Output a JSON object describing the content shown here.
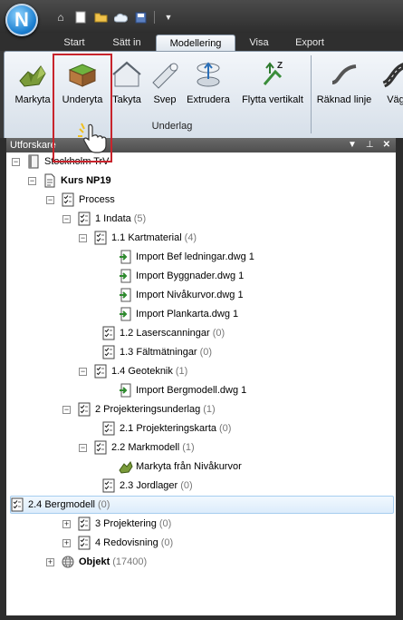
{
  "app": {
    "logo_letter": "N"
  },
  "qat": {
    "icons": [
      "home-icon",
      "new-file-icon",
      "open-folder-icon",
      "cloud-icon",
      "save-icon",
      "dropdown-arrow-icon"
    ]
  },
  "tabs": [
    {
      "label": "Start"
    },
    {
      "label": "Sätt in"
    },
    {
      "label": "Modellering",
      "active": true
    },
    {
      "label": "Visa"
    },
    {
      "label": "Export"
    }
  ],
  "ribbon": {
    "buttons": [
      {
        "label": "Markyta",
        "icon": "terrain-surface-icon"
      },
      {
        "label": "Underyta",
        "icon": "subsurface-icon",
        "highlighted": true
      },
      {
        "label": "Takyta",
        "icon": "roof-surface-icon"
      },
      {
        "label": "Svep",
        "icon": "sweep-icon"
      },
      {
        "label": "Extrudera",
        "icon": "extrude-icon"
      },
      {
        "label": "Flytta vertikalt",
        "icon": "move-vertical-icon"
      },
      {
        "label": "Räknad linje",
        "icon": "calculated-line-icon"
      },
      {
        "label": "Väg",
        "icon": "road-icon"
      }
    ],
    "group_label": "Underlag"
  },
  "panel": {
    "title": "Utforskare",
    "controls": [
      "dropdown-arrow-icon",
      "pin-icon",
      "close-icon"
    ]
  },
  "tree": [
    {
      "label": "Stockholm TrV",
      "count": "",
      "level": 0,
      "expander": "-",
      "icon": "book-icon"
    },
    {
      "label": "Kurs NP19",
      "count": "",
      "level": 1,
      "expander": "-",
      "icon": "document-icon",
      "bold": true
    },
    {
      "label": "Process",
      "count": "",
      "level": 2,
      "expander": "-",
      "icon": "checklist-icon"
    },
    {
      "label": "1 Indata",
      "count": "(5)",
      "level": 3,
      "expander": "-",
      "icon": "checklist-icon"
    },
    {
      "label": "1.1 Kartmaterial",
      "count": "(4)",
      "level": 4,
      "expander": "-",
      "icon": "checklist-icon"
    },
    {
      "label": "Import Bef ledningar.dwg 1",
      "count": "",
      "level": 6,
      "expander": "",
      "icon": "import-icon"
    },
    {
      "label": "Import Byggnader.dwg 1",
      "count": "",
      "level": 6,
      "expander": "",
      "icon": "import-icon"
    },
    {
      "label": "Import Nivåkurvor.dwg 1",
      "count": "",
      "level": 6,
      "expander": "",
      "icon": "import-icon"
    },
    {
      "label": "Import Plankarta.dwg 1",
      "count": "",
      "level": 6,
      "expander": "",
      "icon": "import-icon"
    },
    {
      "label": "1.2 Laserscanningar",
      "count": "(0)",
      "level": 5,
      "expander": "",
      "icon": "checklist-icon"
    },
    {
      "label": "1.3 Fältmätningar",
      "count": "(0)",
      "level": 5,
      "expander": "",
      "icon": "checklist-icon"
    },
    {
      "label": "1.4 Geoteknik",
      "count": "(1)",
      "level": 4,
      "expander": "-",
      "icon": "checklist-icon"
    },
    {
      "label": "Import Bergmodell.dwg 1",
      "count": "",
      "level": 6,
      "expander": "",
      "icon": "import-icon"
    },
    {
      "label": "2 Projekteringsunderlag",
      "count": "(1)",
      "level": 3,
      "expander": "-",
      "icon": "checklist-icon"
    },
    {
      "label": "2.1 Projekteringskarta",
      "count": "(0)",
      "level": 5,
      "expander": "",
      "icon": "checklist-icon"
    },
    {
      "label": "2.2 Markmodell",
      "count": "(1)",
      "level": 4,
      "expander": "-",
      "icon": "checklist-icon"
    },
    {
      "label": "Markyta från Nivåkurvor",
      "count": "",
      "level": 6,
      "expander": "",
      "icon": "terrain-surface-icon"
    },
    {
      "label": "2.3 Jordlager",
      "count": "(0)",
      "level": 5,
      "expander": "",
      "icon": "checklist-icon"
    },
    {
      "label": "2.4 Bergmodell",
      "count": "(0)",
      "level": 5,
      "expander": "",
      "icon": "checklist-icon",
      "selected": true
    },
    {
      "label": "3 Projektering",
      "count": "(0)",
      "level": 3,
      "expander": "+",
      "icon": "checklist-icon"
    },
    {
      "label": "4 Redovisning",
      "count": "(0)",
      "level": 3,
      "expander": "+",
      "icon": "checklist-icon"
    },
    {
      "label": "Objekt",
      "count": "(17400)",
      "level": 2,
      "expander": "+",
      "icon": "globe-icon",
      "bold": true
    }
  ]
}
